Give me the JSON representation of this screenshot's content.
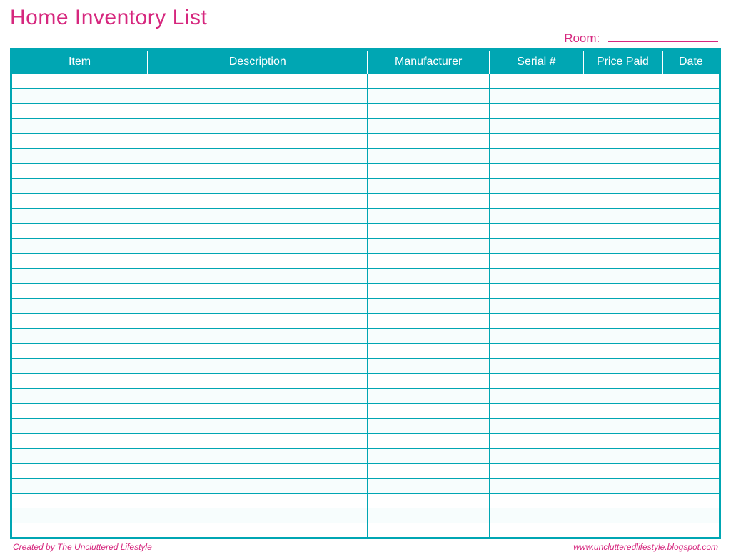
{
  "title": "Home Inventory List",
  "room_label": "Room:",
  "columns": [
    "Item",
    "Description",
    "Manufacturer",
    "Serial #",
    "Price Paid",
    "Date"
  ],
  "row_count": 31,
  "footer_left": "Created by The Uncluttered Lifestyle",
  "footer_right": "www.unclutteredlifestyle.blogspot.com"
}
